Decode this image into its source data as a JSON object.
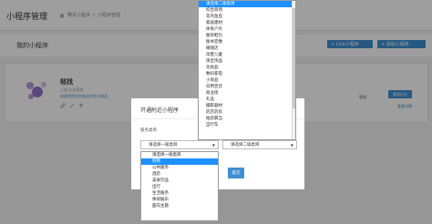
{
  "header": {
    "title": "小程序管理",
    "crumb1": "腾讯小程序",
    "crumb_sep": "/",
    "crumb2": "小程序管理"
  },
  "section": {
    "title": "我的小程序",
    "btn_link": "+ Link小程序",
    "btn_add": "+ 添加小程序"
  },
  "card": {
    "name": "轻找",
    "sub": "上线 企业管理",
    "desc": "快速找附近的商店信息与商品",
    "label": "管理",
    "btn": "管理后台",
    "foot": "查看详情"
  },
  "modal": {
    "title": "开通附近小程序",
    "close": "×",
    "label": "服务类目",
    "select1_value": "请选择一级类目",
    "select2_value": "请选择二级类目",
    "ok": "提交"
  },
  "dropdown1": {
    "items": [
      "请选择一级类目",
      "购物",
      "公共服务",
      "酒店",
      "美食饮品",
      "出行",
      "生活服务",
      "休闲娱乐",
      "面向主题"
    ],
    "selected_index": 1
  },
  "dropdown2": {
    "items": [
      "请选择二级类目",
      "综合商场",
      "花鸟鱼虫",
      "家居建材",
      "体育户外",
      "服饰鞋包",
      "图书音像",
      "眼镜店",
      "母婴儿童",
      "珠宝饰品",
      "化妆品",
      "数码家电",
      "小商品",
      "日用百货",
      "商业街",
      "礼品",
      "摄影器材",
      "药店药房",
      "拍卖典当",
      "自行车"
    ],
    "selected_index": 0
  }
}
